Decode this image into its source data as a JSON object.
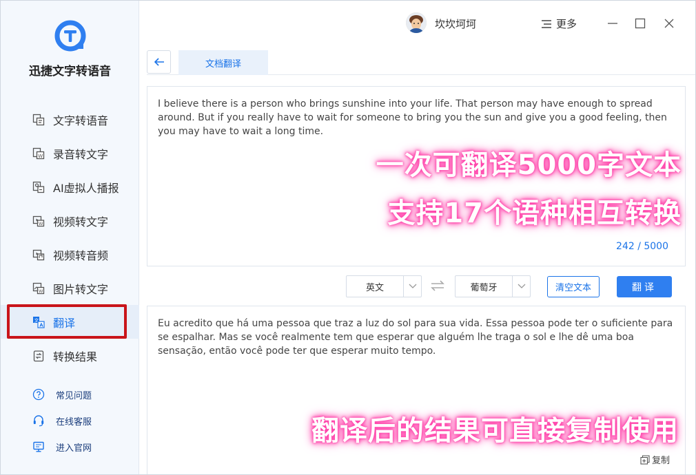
{
  "app": {
    "name": "迅捷文字转语音"
  },
  "user": {
    "name": "坎坎坷坷"
  },
  "header": {
    "more_label": "更多"
  },
  "sidebar": {
    "items": [
      {
        "label": "文字转语音",
        "icon": "text-to-speech-icon"
      },
      {
        "label": "录音转文字",
        "icon": "audio-to-text-icon"
      },
      {
        "label": "AI虚拟人播报",
        "icon": "virtual-anchor-icon"
      },
      {
        "label": "视频转文字",
        "icon": "video-to-text-icon"
      },
      {
        "label": "视频转音频",
        "icon": "video-to-audio-icon"
      },
      {
        "label": "图片转文字",
        "icon": "image-to-text-icon"
      },
      {
        "label": "翻译",
        "icon": "translate-icon"
      },
      {
        "label": "转换结果",
        "icon": "results-icon"
      }
    ],
    "active_index": 6,
    "links": [
      {
        "label": "常见问题",
        "icon": "question-icon"
      },
      {
        "label": "在线客服",
        "icon": "headset-icon"
      },
      {
        "label": "进入官网",
        "icon": "monitor-icon"
      }
    ]
  },
  "tabs": {
    "active": "文档翻译"
  },
  "source": {
    "text": "I believe there is a person who brings sunshine into your life. That person may have enough to spread around. But if you really have to wait for someone to bring you the sun and give you a good feeling, then you may have to wait a long time.",
    "counter": "242 / 5000"
  },
  "promo": {
    "line1": "一次可翻译5000字文本",
    "line2": "支持17个语种相互转换",
    "line3": "翻译后的结果可直接复制使用"
  },
  "controls": {
    "source_lang": "英文",
    "target_lang": "葡萄牙",
    "clear_label": "清空文本",
    "translate_label": "翻译"
  },
  "output": {
    "text": "Eu acredito que há uma pessoa que traz a luz do sol para sua vida. Essa pessoa pode ter o suficiente para se espalhar. Mas se você realmente tem que esperar que alguém lhe traga o sol e lhe dê uma boa sensação, então você pode ter que esperar muito tempo.",
    "copy_label": "复制"
  },
  "colors": {
    "accent": "#1a73e8",
    "highlight": "#c9141a",
    "glow": "#ff3ea8"
  }
}
